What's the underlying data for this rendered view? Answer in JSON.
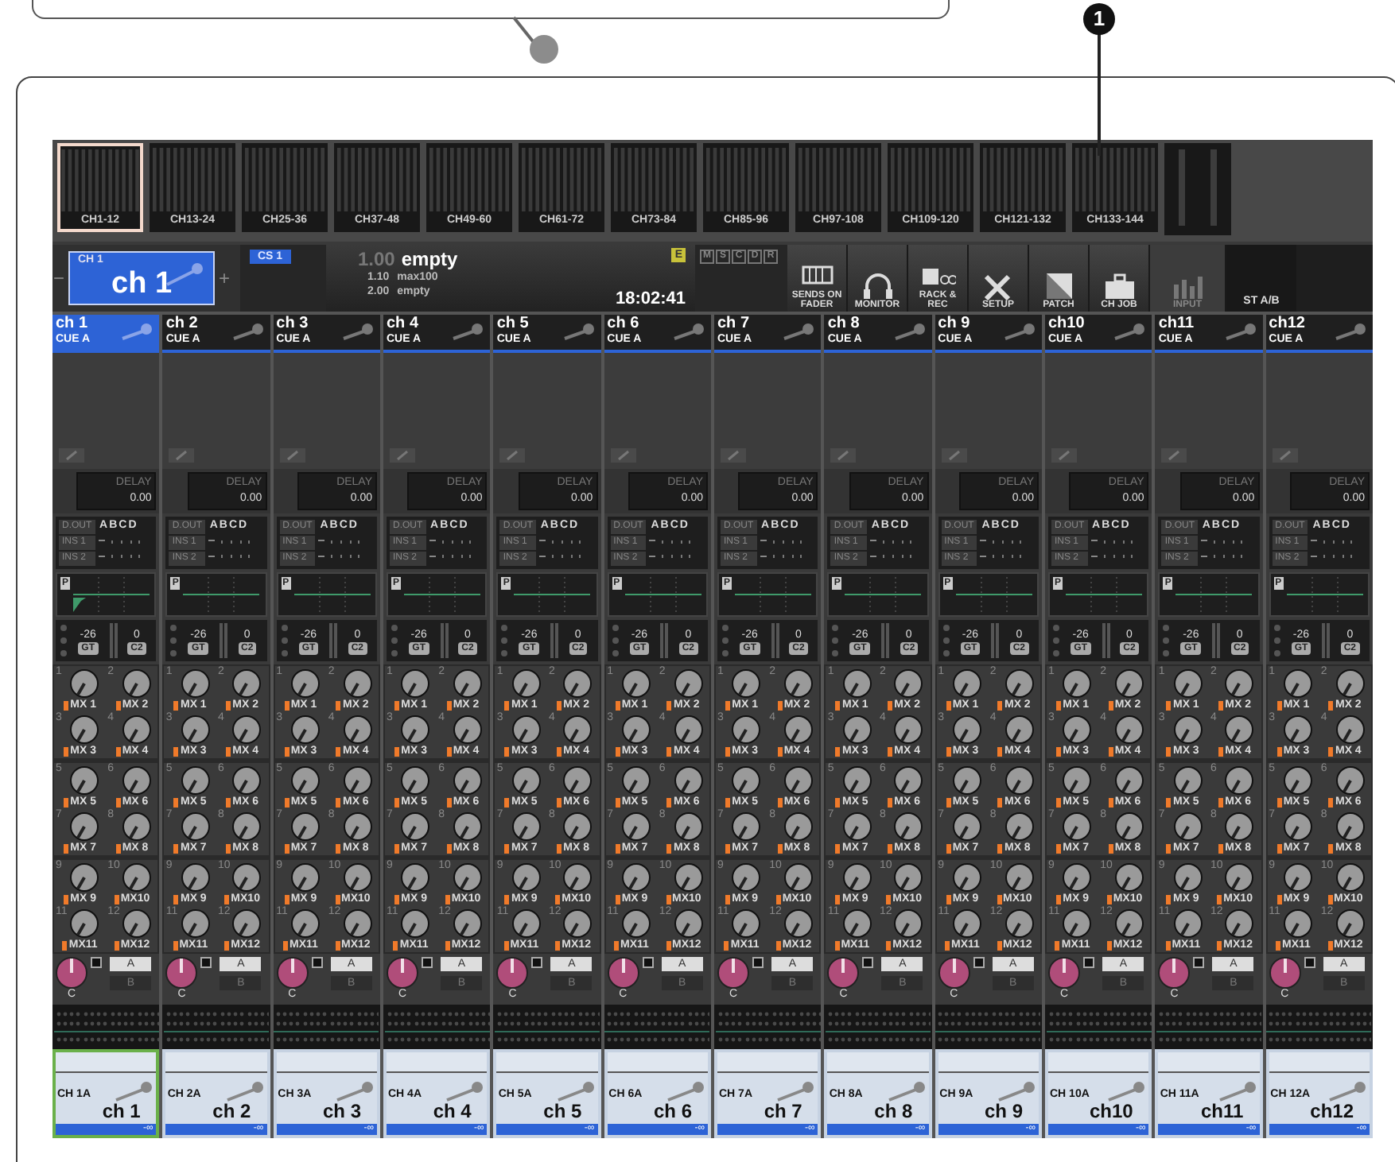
{
  "callouts": [
    {
      "number": "1"
    }
  ],
  "banks": [
    {
      "label": "CH1-12",
      "selected": true
    },
    {
      "label": "CH13-24",
      "selected": false
    },
    {
      "label": "CH25-36",
      "selected": false
    },
    {
      "label": "CH37-48",
      "selected": false
    },
    {
      "label": "CH49-60",
      "selected": false
    },
    {
      "label": "CH61-72",
      "selected": false
    },
    {
      "label": "CH73-84",
      "selected": false
    },
    {
      "label": "CH85-96",
      "selected": false
    },
    {
      "label": "CH97-108",
      "selected": false
    },
    {
      "label": "CH109-120",
      "selected": false
    },
    {
      "label": "CH121-132",
      "selected": false
    },
    {
      "label": "CH133-144",
      "selected": false
    }
  ],
  "channel_select": {
    "minus": "−",
    "plus": "+",
    "number": "CH 1",
    "name": "ch 1"
  },
  "custom_set": "CS 1",
  "scene": {
    "number": "1.00",
    "title": "empty",
    "next": [
      {
        "number": "1.10",
        "title": "max100"
      },
      {
        "number": "2.00",
        "title": "empty"
      }
    ],
    "badge": "E",
    "time": "18:02:41"
  },
  "indicators": [
    "M",
    "S",
    "C",
    "D",
    "R"
  ],
  "tools": [
    {
      "kind": "sends",
      "label": "SENDS ON FADER",
      "disabled": false
    },
    {
      "kind": "monitor",
      "label": "MONITOR",
      "disabled": false
    },
    {
      "kind": "rack",
      "label": "RACK & REC",
      "disabled": false
    },
    {
      "kind": "setup",
      "label": "SETUP",
      "disabled": false
    },
    {
      "kind": "patch",
      "label": "PATCH",
      "disabled": false
    },
    {
      "kind": "job",
      "label": "CH JOB",
      "disabled": false
    },
    {
      "kind": "input",
      "label": "INPUT",
      "disabled": true
    }
  ],
  "stereo_label": "ST A/B",
  "strips": [
    {
      "name": "ch 1",
      "cue": "CUE A",
      "selected": true,
      "delay_label": "DELAY",
      "delay": "0.00",
      "dout": "D.OUT",
      "buses": "ABCD",
      "inserts": [
        "INS 1",
        "INS 2"
      ],
      "eq": "P",
      "gate_value": "-26",
      "gate": "GT",
      "comp_value": "0",
      "comp": "C2",
      "sends": [
        {
          "number": "1",
          "bus": "MX 1"
        },
        {
          "number": "2",
          "bus": "MX 2"
        },
        {
          "number": "3",
          "bus": "MX 3"
        },
        {
          "number": "4",
          "bus": "MX 4"
        },
        {
          "number": "5",
          "bus": "MX 5"
        },
        {
          "number": "6",
          "bus": "MX 6"
        },
        {
          "number": "7",
          "bus": "MX 7"
        },
        {
          "number": "8",
          "bus": "MX 8"
        },
        {
          "number": "9",
          "bus": "MX 9"
        },
        {
          "number": "10",
          "bus": "MX10"
        },
        {
          "number": "11",
          "bus": "MX11"
        },
        {
          "number": "12",
          "bus": "MX12"
        }
      ],
      "pan": "C",
      "route_a": "A",
      "route_b": "B",
      "fader_id": "CH 1A",
      "fader_name": "ch 1",
      "fader_level": "-∞"
    },
    {
      "name": "ch 2",
      "cue": "CUE A",
      "selected": false,
      "delay_label": "DELAY",
      "delay": "0.00",
      "dout": "D.OUT",
      "buses": "ABCD",
      "inserts": [
        "INS 1",
        "INS 2"
      ],
      "eq": "P",
      "gate_value": "-26",
      "gate": "GT",
      "comp_value": "0",
      "comp": "C2",
      "sends": [
        {
          "number": "1",
          "bus": "MX 1"
        },
        {
          "number": "2",
          "bus": "MX 2"
        },
        {
          "number": "3",
          "bus": "MX 3"
        },
        {
          "number": "4",
          "bus": "MX 4"
        },
        {
          "number": "5",
          "bus": "MX 5"
        },
        {
          "number": "6",
          "bus": "MX 6"
        },
        {
          "number": "7",
          "bus": "MX 7"
        },
        {
          "number": "8",
          "bus": "MX 8"
        },
        {
          "number": "9",
          "bus": "MX 9"
        },
        {
          "number": "10",
          "bus": "MX10"
        },
        {
          "number": "11",
          "bus": "MX11"
        },
        {
          "number": "12",
          "bus": "MX12"
        }
      ],
      "pan": "C",
      "route_a": "A",
      "route_b": "B",
      "fader_id": "CH 2A",
      "fader_name": "ch 2",
      "fader_level": "-∞"
    },
    {
      "name": "ch 3",
      "cue": "CUE A",
      "selected": false,
      "delay_label": "DELAY",
      "delay": "0.00",
      "dout": "D.OUT",
      "buses": "ABCD",
      "inserts": [
        "INS 1",
        "INS 2"
      ],
      "eq": "P",
      "gate_value": "-26",
      "gate": "GT",
      "comp_value": "0",
      "comp": "C2",
      "sends": [
        {
          "number": "1",
          "bus": "MX 1"
        },
        {
          "number": "2",
          "bus": "MX 2"
        },
        {
          "number": "3",
          "bus": "MX 3"
        },
        {
          "number": "4",
          "bus": "MX 4"
        },
        {
          "number": "5",
          "bus": "MX 5"
        },
        {
          "number": "6",
          "bus": "MX 6"
        },
        {
          "number": "7",
          "bus": "MX 7"
        },
        {
          "number": "8",
          "bus": "MX 8"
        },
        {
          "number": "9",
          "bus": "MX 9"
        },
        {
          "number": "10",
          "bus": "MX10"
        },
        {
          "number": "11",
          "bus": "MX11"
        },
        {
          "number": "12",
          "bus": "MX12"
        }
      ],
      "pan": "C",
      "route_a": "A",
      "route_b": "B",
      "fader_id": "CH 3A",
      "fader_name": "ch 3",
      "fader_level": "-∞"
    },
    {
      "name": "ch 4",
      "cue": "CUE A",
      "selected": false,
      "delay_label": "DELAY",
      "delay": "0.00",
      "dout": "D.OUT",
      "buses": "ABCD",
      "inserts": [
        "INS 1",
        "INS 2"
      ],
      "eq": "P",
      "gate_value": "-26",
      "gate": "GT",
      "comp_value": "0",
      "comp": "C2",
      "sends": [
        {
          "number": "1",
          "bus": "MX 1"
        },
        {
          "number": "2",
          "bus": "MX 2"
        },
        {
          "number": "3",
          "bus": "MX 3"
        },
        {
          "number": "4",
          "bus": "MX 4"
        },
        {
          "number": "5",
          "bus": "MX 5"
        },
        {
          "number": "6",
          "bus": "MX 6"
        },
        {
          "number": "7",
          "bus": "MX 7"
        },
        {
          "number": "8",
          "bus": "MX 8"
        },
        {
          "number": "9",
          "bus": "MX 9"
        },
        {
          "number": "10",
          "bus": "MX10"
        },
        {
          "number": "11",
          "bus": "MX11"
        },
        {
          "number": "12",
          "bus": "MX12"
        }
      ],
      "pan": "C",
      "route_a": "A",
      "route_b": "B",
      "fader_id": "CH 4A",
      "fader_name": "ch 4",
      "fader_level": "-∞"
    },
    {
      "name": "ch 5",
      "cue": "CUE A",
      "selected": false,
      "delay_label": "DELAY",
      "delay": "0.00",
      "dout": "D.OUT",
      "buses": "ABCD",
      "inserts": [
        "INS 1",
        "INS 2"
      ],
      "eq": "P",
      "gate_value": "-26",
      "gate": "GT",
      "comp_value": "0",
      "comp": "C2",
      "sends": [
        {
          "number": "1",
          "bus": "MX 1"
        },
        {
          "number": "2",
          "bus": "MX 2"
        },
        {
          "number": "3",
          "bus": "MX 3"
        },
        {
          "number": "4",
          "bus": "MX 4"
        },
        {
          "number": "5",
          "bus": "MX 5"
        },
        {
          "number": "6",
          "bus": "MX 6"
        },
        {
          "number": "7",
          "bus": "MX 7"
        },
        {
          "number": "8",
          "bus": "MX 8"
        },
        {
          "number": "9",
          "bus": "MX 9"
        },
        {
          "number": "10",
          "bus": "MX10"
        },
        {
          "number": "11",
          "bus": "MX11"
        },
        {
          "number": "12",
          "bus": "MX12"
        }
      ],
      "pan": "C",
      "route_a": "A",
      "route_b": "B",
      "fader_id": "CH 5A",
      "fader_name": "ch 5",
      "fader_level": "-∞"
    },
    {
      "name": "ch 6",
      "cue": "CUE A",
      "selected": false,
      "delay_label": "DELAY",
      "delay": "0.00",
      "dout": "D.OUT",
      "buses": "ABCD",
      "inserts": [
        "INS 1",
        "INS 2"
      ],
      "eq": "P",
      "gate_value": "-26",
      "gate": "GT",
      "comp_value": "0",
      "comp": "C2",
      "sends": [
        {
          "number": "1",
          "bus": "MX 1"
        },
        {
          "number": "2",
          "bus": "MX 2"
        },
        {
          "number": "3",
          "bus": "MX 3"
        },
        {
          "number": "4",
          "bus": "MX 4"
        },
        {
          "number": "5",
          "bus": "MX 5"
        },
        {
          "number": "6",
          "bus": "MX 6"
        },
        {
          "number": "7",
          "bus": "MX 7"
        },
        {
          "number": "8",
          "bus": "MX 8"
        },
        {
          "number": "9",
          "bus": "MX 9"
        },
        {
          "number": "10",
          "bus": "MX10"
        },
        {
          "number": "11",
          "bus": "MX11"
        },
        {
          "number": "12",
          "bus": "MX12"
        }
      ],
      "pan": "C",
      "route_a": "A",
      "route_b": "B",
      "fader_id": "CH 6A",
      "fader_name": "ch 6",
      "fader_level": "-∞"
    },
    {
      "name": "ch 7",
      "cue": "CUE A",
      "selected": false,
      "delay_label": "DELAY",
      "delay": "0.00",
      "dout": "D.OUT",
      "buses": "ABCD",
      "inserts": [
        "INS 1",
        "INS 2"
      ],
      "eq": "P",
      "gate_value": "-26",
      "gate": "GT",
      "comp_value": "0",
      "comp": "C2",
      "sends": [
        {
          "number": "1",
          "bus": "MX 1"
        },
        {
          "number": "2",
          "bus": "MX 2"
        },
        {
          "number": "3",
          "bus": "MX 3"
        },
        {
          "number": "4",
          "bus": "MX 4"
        },
        {
          "number": "5",
          "bus": "MX 5"
        },
        {
          "number": "6",
          "bus": "MX 6"
        },
        {
          "number": "7",
          "bus": "MX 7"
        },
        {
          "number": "8",
          "bus": "MX 8"
        },
        {
          "number": "9",
          "bus": "MX 9"
        },
        {
          "number": "10",
          "bus": "MX10"
        },
        {
          "number": "11",
          "bus": "MX11"
        },
        {
          "number": "12",
          "bus": "MX12"
        }
      ],
      "pan": "C",
      "route_a": "A",
      "route_b": "B",
      "fader_id": "CH 7A",
      "fader_name": "ch 7",
      "fader_level": "-∞"
    },
    {
      "name": "ch 8",
      "cue": "CUE A",
      "selected": false,
      "delay_label": "DELAY",
      "delay": "0.00",
      "dout": "D.OUT",
      "buses": "ABCD",
      "inserts": [
        "INS 1",
        "INS 2"
      ],
      "eq": "P",
      "gate_value": "-26",
      "gate": "GT",
      "comp_value": "0",
      "comp": "C2",
      "sends": [
        {
          "number": "1",
          "bus": "MX 1"
        },
        {
          "number": "2",
          "bus": "MX 2"
        },
        {
          "number": "3",
          "bus": "MX 3"
        },
        {
          "number": "4",
          "bus": "MX 4"
        },
        {
          "number": "5",
          "bus": "MX 5"
        },
        {
          "number": "6",
          "bus": "MX 6"
        },
        {
          "number": "7",
          "bus": "MX 7"
        },
        {
          "number": "8",
          "bus": "MX 8"
        },
        {
          "number": "9",
          "bus": "MX 9"
        },
        {
          "number": "10",
          "bus": "MX10"
        },
        {
          "number": "11",
          "bus": "MX11"
        },
        {
          "number": "12",
          "bus": "MX12"
        }
      ],
      "pan": "C",
      "route_a": "A",
      "route_b": "B",
      "fader_id": "CH 8A",
      "fader_name": "ch 8",
      "fader_level": "-∞"
    },
    {
      "name": "ch 9",
      "cue": "CUE A",
      "selected": false,
      "delay_label": "DELAY",
      "delay": "0.00",
      "dout": "D.OUT",
      "buses": "ABCD",
      "inserts": [
        "INS 1",
        "INS 2"
      ],
      "eq": "P",
      "gate_value": "-26",
      "gate": "GT",
      "comp_value": "0",
      "comp": "C2",
      "sends": [
        {
          "number": "1",
          "bus": "MX 1"
        },
        {
          "number": "2",
          "bus": "MX 2"
        },
        {
          "number": "3",
          "bus": "MX 3"
        },
        {
          "number": "4",
          "bus": "MX 4"
        },
        {
          "number": "5",
          "bus": "MX 5"
        },
        {
          "number": "6",
          "bus": "MX 6"
        },
        {
          "number": "7",
          "bus": "MX 7"
        },
        {
          "number": "8",
          "bus": "MX 8"
        },
        {
          "number": "9",
          "bus": "MX 9"
        },
        {
          "number": "10",
          "bus": "MX10"
        },
        {
          "number": "11",
          "bus": "MX11"
        },
        {
          "number": "12",
          "bus": "MX12"
        }
      ],
      "pan": "C",
      "route_a": "A",
      "route_b": "B",
      "fader_id": "CH 9A",
      "fader_name": "ch 9",
      "fader_level": "-∞"
    },
    {
      "name": "ch10",
      "cue": "CUE A",
      "selected": false,
      "delay_label": "DELAY",
      "delay": "0.00",
      "dout": "D.OUT",
      "buses": "ABCD",
      "inserts": [
        "INS 1",
        "INS 2"
      ],
      "eq": "P",
      "gate_value": "-26",
      "gate": "GT",
      "comp_value": "0",
      "comp": "C2",
      "sends": [
        {
          "number": "1",
          "bus": "MX 1"
        },
        {
          "number": "2",
          "bus": "MX 2"
        },
        {
          "number": "3",
          "bus": "MX 3"
        },
        {
          "number": "4",
          "bus": "MX 4"
        },
        {
          "number": "5",
          "bus": "MX 5"
        },
        {
          "number": "6",
          "bus": "MX 6"
        },
        {
          "number": "7",
          "bus": "MX 7"
        },
        {
          "number": "8",
          "bus": "MX 8"
        },
        {
          "number": "9",
          "bus": "MX 9"
        },
        {
          "number": "10",
          "bus": "MX10"
        },
        {
          "number": "11",
          "bus": "MX11"
        },
        {
          "number": "12",
          "bus": "MX12"
        }
      ],
      "pan": "C",
      "route_a": "A",
      "route_b": "B",
      "fader_id": "CH 10A",
      "fader_name": "ch10",
      "fader_level": "-∞"
    },
    {
      "name": "ch11",
      "cue": "CUE A",
      "selected": false,
      "delay_label": "DELAY",
      "delay": "0.00",
      "dout": "D.OUT",
      "buses": "ABCD",
      "inserts": [
        "INS 1",
        "INS 2"
      ],
      "eq": "P",
      "gate_value": "-26",
      "gate": "GT",
      "comp_value": "0",
      "comp": "C2",
      "sends": [
        {
          "number": "1",
          "bus": "MX 1"
        },
        {
          "number": "2",
          "bus": "MX 2"
        },
        {
          "number": "3",
          "bus": "MX 3"
        },
        {
          "number": "4",
          "bus": "MX 4"
        },
        {
          "number": "5",
          "bus": "MX 5"
        },
        {
          "number": "6",
          "bus": "MX 6"
        },
        {
          "number": "7",
          "bus": "MX 7"
        },
        {
          "number": "8",
          "bus": "MX 8"
        },
        {
          "number": "9",
          "bus": "MX 9"
        },
        {
          "number": "10",
          "bus": "MX10"
        },
        {
          "number": "11",
          "bus": "MX11"
        },
        {
          "number": "12",
          "bus": "MX12"
        }
      ],
      "pan": "C",
      "route_a": "A",
      "route_b": "B",
      "fader_id": "CH 11A",
      "fader_name": "ch11",
      "fader_level": "-∞"
    },
    {
      "name": "ch12",
      "cue": "CUE A",
      "selected": false,
      "delay_label": "DELAY",
      "delay": "0.00",
      "dout": "D.OUT",
      "buses": "ABCD",
      "inserts": [
        "INS 1",
        "INS 2"
      ],
      "eq": "P",
      "gate_value": "-26",
      "gate": "GT",
      "comp_value": "0",
      "comp": "C2",
      "sends": [
        {
          "number": "1",
          "bus": "MX 1"
        },
        {
          "number": "2",
          "bus": "MX 2"
        },
        {
          "number": "3",
          "bus": "MX 3"
        },
        {
          "number": "4",
          "bus": "MX 4"
        },
        {
          "number": "5",
          "bus": "MX 5"
        },
        {
          "number": "6",
          "bus": "MX 6"
        },
        {
          "number": "7",
          "bus": "MX 7"
        },
        {
          "number": "8",
          "bus": "MX 8"
        },
        {
          "number": "9",
          "bus": "MX 9"
        },
        {
          "number": "10",
          "bus": "MX10"
        },
        {
          "number": "11",
          "bus": "MX11"
        },
        {
          "number": "12",
          "bus": "MX12"
        }
      ],
      "pan": "C",
      "route_a": "A",
      "route_b": "B",
      "fader_id": "CH 12A",
      "fader_name": "ch12",
      "fader_level": "-∞"
    }
  ]
}
